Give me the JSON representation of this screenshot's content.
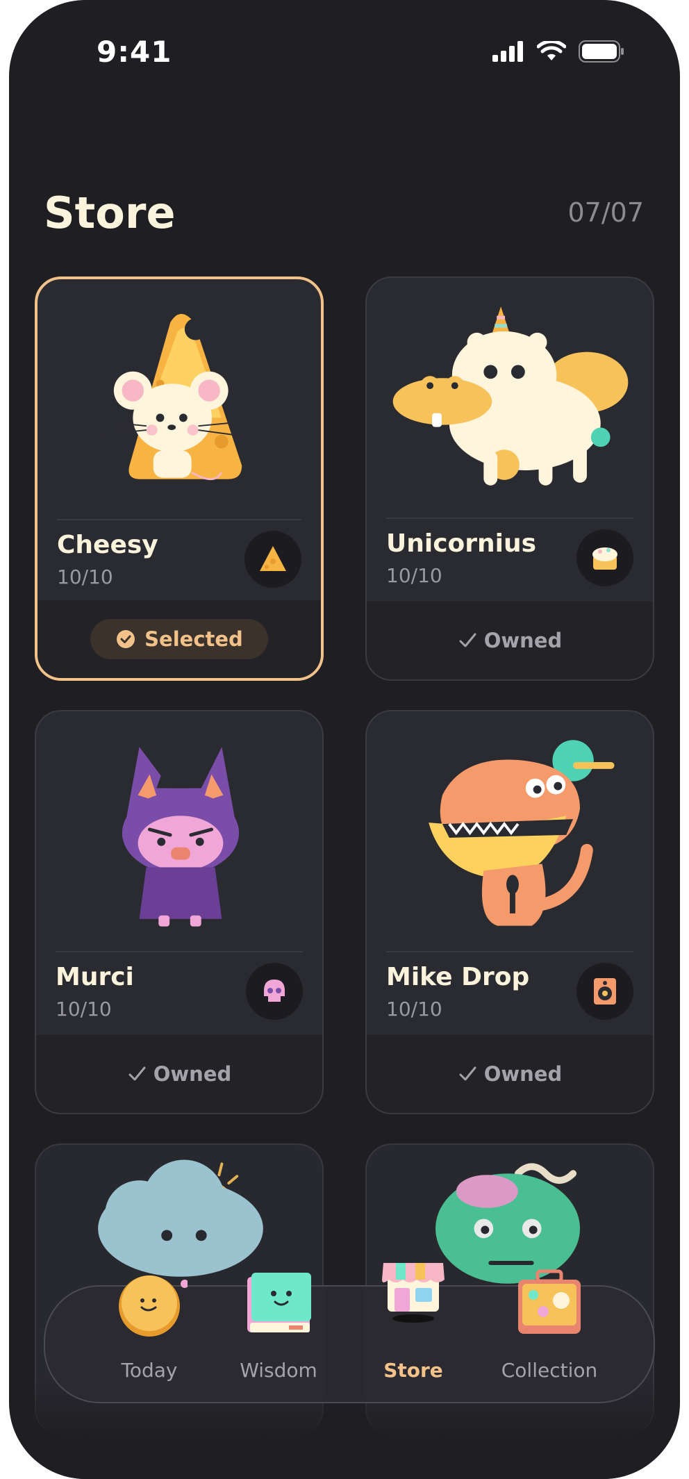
{
  "status_bar": {
    "time": "9:41"
  },
  "header": {
    "title": "Store",
    "count": "07/07"
  },
  "cards": [
    {
      "name": "Cheesy",
      "progress": "10/10",
      "status": "Selected"
    },
    {
      "name": "Unicornius",
      "progress": "10/10",
      "status": "Owned"
    },
    {
      "name": "Murci",
      "progress": "10/10",
      "status": "Owned"
    },
    {
      "name": "Mike Drop",
      "progress": "10/10",
      "status": "Owned"
    }
  ],
  "nav": {
    "items": [
      {
        "label": "Today"
      },
      {
        "label": "Wisdom"
      },
      {
        "label": "Store"
      },
      {
        "label": "Collection"
      }
    ]
  },
  "colors": {
    "background": "#1f1f23",
    "accent": "#f2c28a",
    "card": "#2a2a31",
    "text": "#fbf3dc"
  }
}
